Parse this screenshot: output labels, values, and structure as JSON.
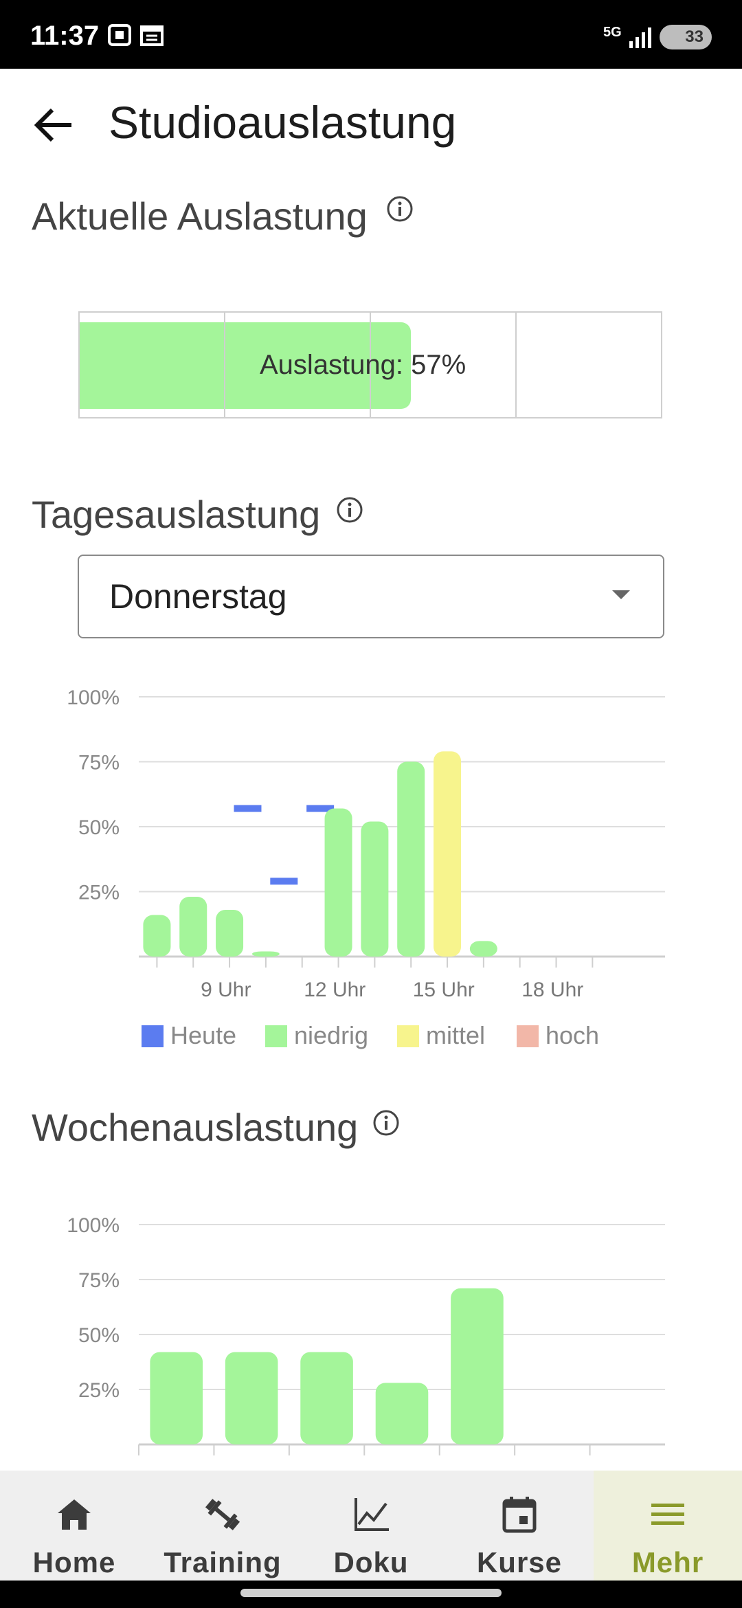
{
  "status_bar": {
    "time": "11:37",
    "network": "5G",
    "battery": "33"
  },
  "header": {
    "title": "Studioauslastung"
  },
  "current": {
    "title": "Aktuelle Auslastung",
    "percent": 57,
    "label": "Auslastung: 57%"
  },
  "daily": {
    "title": "Tagesauslastung",
    "selected_day": "Donnerstag"
  },
  "weekly": {
    "title": "Wochenauslastung"
  },
  "chart_data": [
    {
      "type": "bar",
      "x_tick_labels": [
        "9 Uhr",
        "12 Uhr",
        "15 Uhr",
        "18 Uhr"
      ],
      "y_tick_labels": [
        "100%",
        "75%",
        "50%",
        "25%"
      ],
      "ylim": [
        0,
        100
      ],
      "grid": true,
      "legend": [
        "Heute",
        "niedrig",
        "mittel",
        "hoch"
      ],
      "legend_colors": [
        "#5b7cf0",
        "#a4f59a",
        "#f7f48d",
        "#f2b7a8"
      ],
      "legend_position": "bottom",
      "hour_slots": [
        7,
        8,
        9,
        10,
        11,
        12,
        13,
        14,
        15,
        16,
        17,
        18,
        19
      ],
      "series": [
        {
          "name": "niedrig/mittel",
          "values": [
            16,
            23,
            18,
            2,
            0,
            57,
            52,
            75,
            79,
            6,
            0,
            0,
            0
          ],
          "levels": [
            "niedrig",
            "niedrig",
            "niedrig",
            "niedrig",
            "niedrig",
            "niedrig",
            "niedrig",
            "niedrig",
            "mittel",
            "niedrig",
            "niedrig",
            "niedrig",
            "niedrig"
          ]
        },
        {
          "name": "Heute",
          "values": [
            null,
            null,
            57,
            29,
            57,
            null,
            null,
            null,
            null,
            null,
            null,
            null,
            null
          ]
        }
      ]
    },
    {
      "type": "bar",
      "y_tick_labels": [
        "100%",
        "75%",
        "50%",
        "25%"
      ],
      "ylim": [
        0,
        100
      ],
      "grid": true,
      "values": [
        42,
        42,
        42,
        28,
        71,
        0,
        0
      ]
    }
  ]
}
